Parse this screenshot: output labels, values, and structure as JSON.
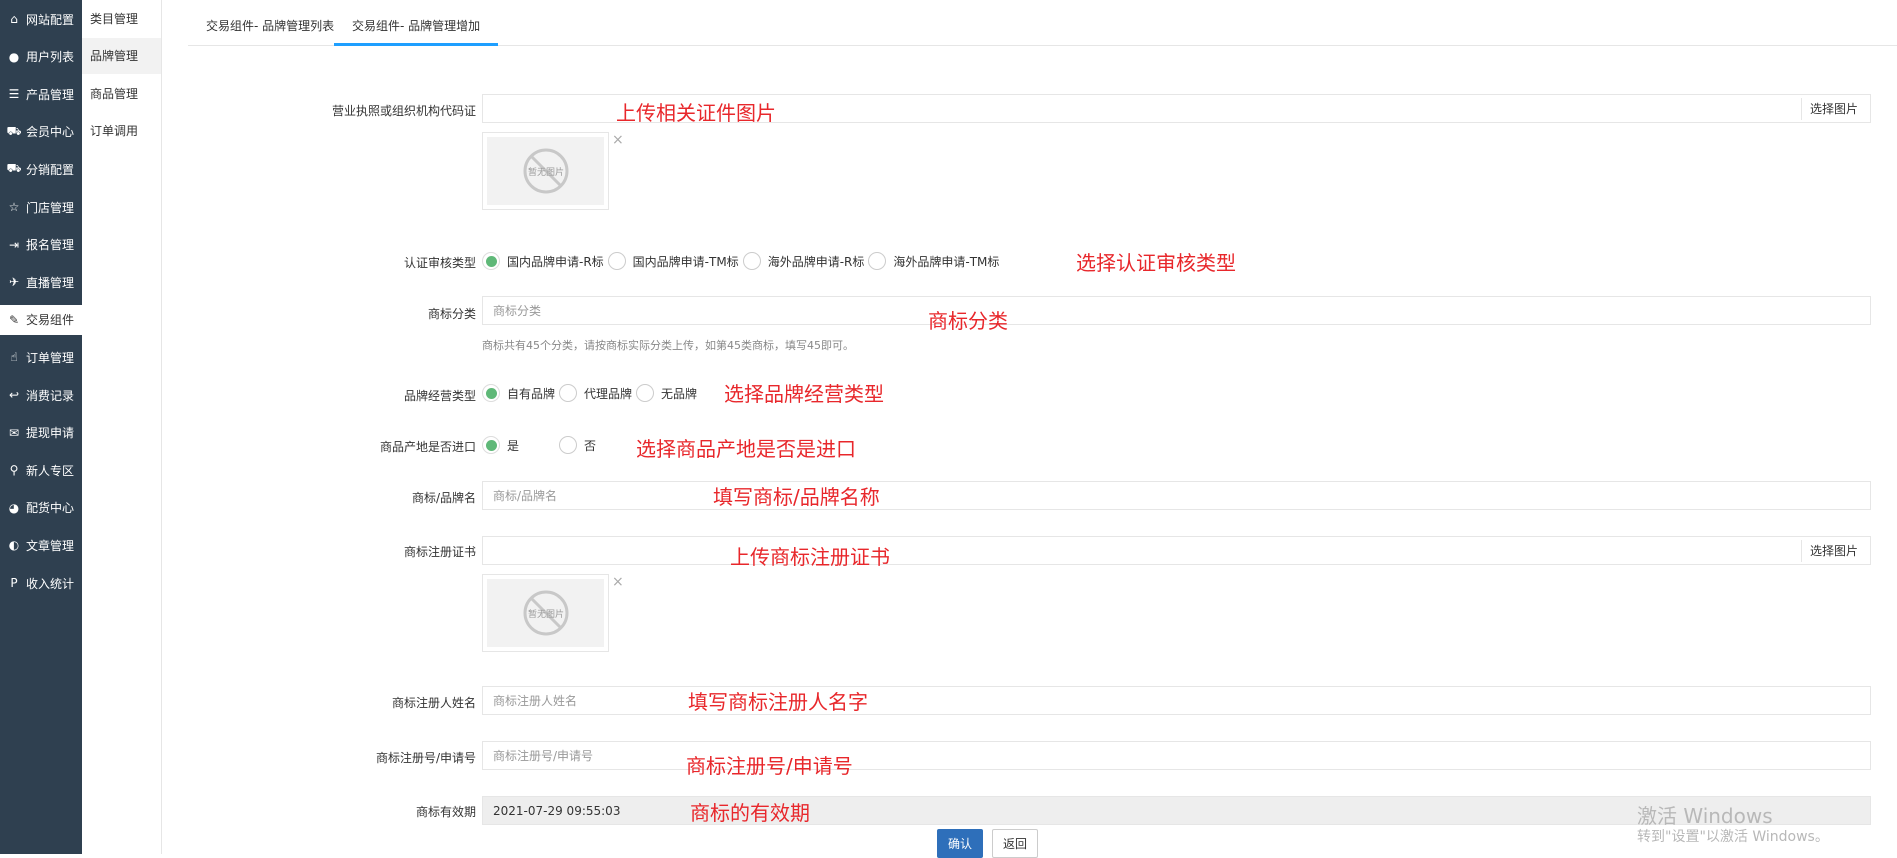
{
  "sidebar": {
    "items": [
      {
        "label": "网站配置",
        "icon": "home-icon",
        "glyph": "⌂"
      },
      {
        "label": "用户列表",
        "icon": "user-icon",
        "glyph": "●"
      },
      {
        "label": "产品管理",
        "icon": "list-icon",
        "glyph": "☰"
      },
      {
        "label": "会员中心",
        "icon": "cart-icon",
        "glyph": "⛟"
      },
      {
        "label": "分销配置",
        "icon": "cart-icon",
        "glyph": "⛟"
      },
      {
        "label": "门店管理",
        "icon": "star-icon",
        "glyph": "☆"
      },
      {
        "label": "报名管理",
        "icon": "signin-icon",
        "glyph": "⇥"
      },
      {
        "label": "直播管理",
        "icon": "plane-icon",
        "glyph": "✈"
      },
      {
        "label": "交易组件",
        "icon": "eraser-icon",
        "glyph": "✎"
      },
      {
        "label": "订单管理",
        "icon": "thumbs-up-icon",
        "glyph": "☝"
      },
      {
        "label": "消费记录",
        "icon": "reply-icon",
        "glyph": "↩"
      },
      {
        "label": "提现申请",
        "icon": "wechat-icon",
        "glyph": "✉"
      },
      {
        "label": "新人专区",
        "icon": "map-pin-icon",
        "glyph": "⚲"
      },
      {
        "label": "配货中心",
        "icon": "pie-chart-icon",
        "glyph": "◕"
      },
      {
        "label": "文章管理",
        "icon": "adjust-icon",
        "glyph": "◐"
      },
      {
        "label": "收入统计",
        "icon": "paypal-icon",
        "glyph": "P"
      }
    ],
    "active_index": 8
  },
  "subnav": {
    "items": [
      "类目管理",
      "品牌管理",
      "商品管理",
      "订单调用"
    ],
    "active_index": 1
  },
  "tabs": [
    "交易组件- 品牌管理列表",
    "交易组件- 品牌管理增加"
  ],
  "form": {
    "license_label": "营业执照或组织机构代码证",
    "pick_image": "选择图片",
    "no_image": "暂无图片",
    "close_glyph": "×",
    "cert_type_label": "认证审核类型",
    "cert_type_options": [
      "国内品牌申请-R标",
      "国内品牌申请-TM标",
      "海外品牌申请-R标",
      "海外品牌申请-TM标"
    ],
    "cert_type_selected": 0,
    "tm_class_label": "商标分类",
    "tm_class_placeholder": "商标分类",
    "tm_class_hint": "商标共有45个分类，请按商标实际分类上传，如第45类商标，填写45即可。",
    "biz_type_label": "品牌经营类型",
    "biz_type_options": [
      "自有品牌",
      "代理品牌",
      "无品牌"
    ],
    "biz_type_selected": 0,
    "import_label": "商品产地是否进口",
    "import_options": [
      "是",
      "否"
    ],
    "import_selected": 0,
    "brand_name_label": "商标/品牌名",
    "brand_name_placeholder": "商标/品牌名",
    "reg_cert_label": "商标注册证书",
    "registrant_label": "商标注册人姓名",
    "registrant_placeholder": "商标注册人姓名",
    "reg_no_label": "商标注册号/申请号",
    "reg_no_placeholder": "商标注册号/申请号",
    "validity_label": "商标有效期",
    "validity_value": "2021-07-29 09:55:03",
    "confirm_button": "确认",
    "back_button": "返回"
  },
  "annotations": {
    "upload_license": "上传相关证件图片",
    "select_cert_type": "选择认证审核类型",
    "tm_class": "商标分类",
    "select_biz_type": "选择品牌经营类型",
    "select_import": "选择商品产地是否是进口",
    "fill_brand_name": "填写商标/品牌名称",
    "upload_reg_cert": "上传商标注册证书",
    "fill_registrant": "填写商标注册人名字",
    "reg_no": "商标注册号/申请号",
    "validity": "商标的有效期"
  },
  "watermark": {
    "line1": "激活 Windows",
    "line2": "转到\"设置\"以激活 Windows。"
  },
  "colors": {
    "sidebar_bg": "#2f4050",
    "radio_checked": "#5fb878",
    "primary_button": "#2e6fba",
    "annotation_red": "#e8272b",
    "active_tab_underline": "#1e9fff"
  }
}
